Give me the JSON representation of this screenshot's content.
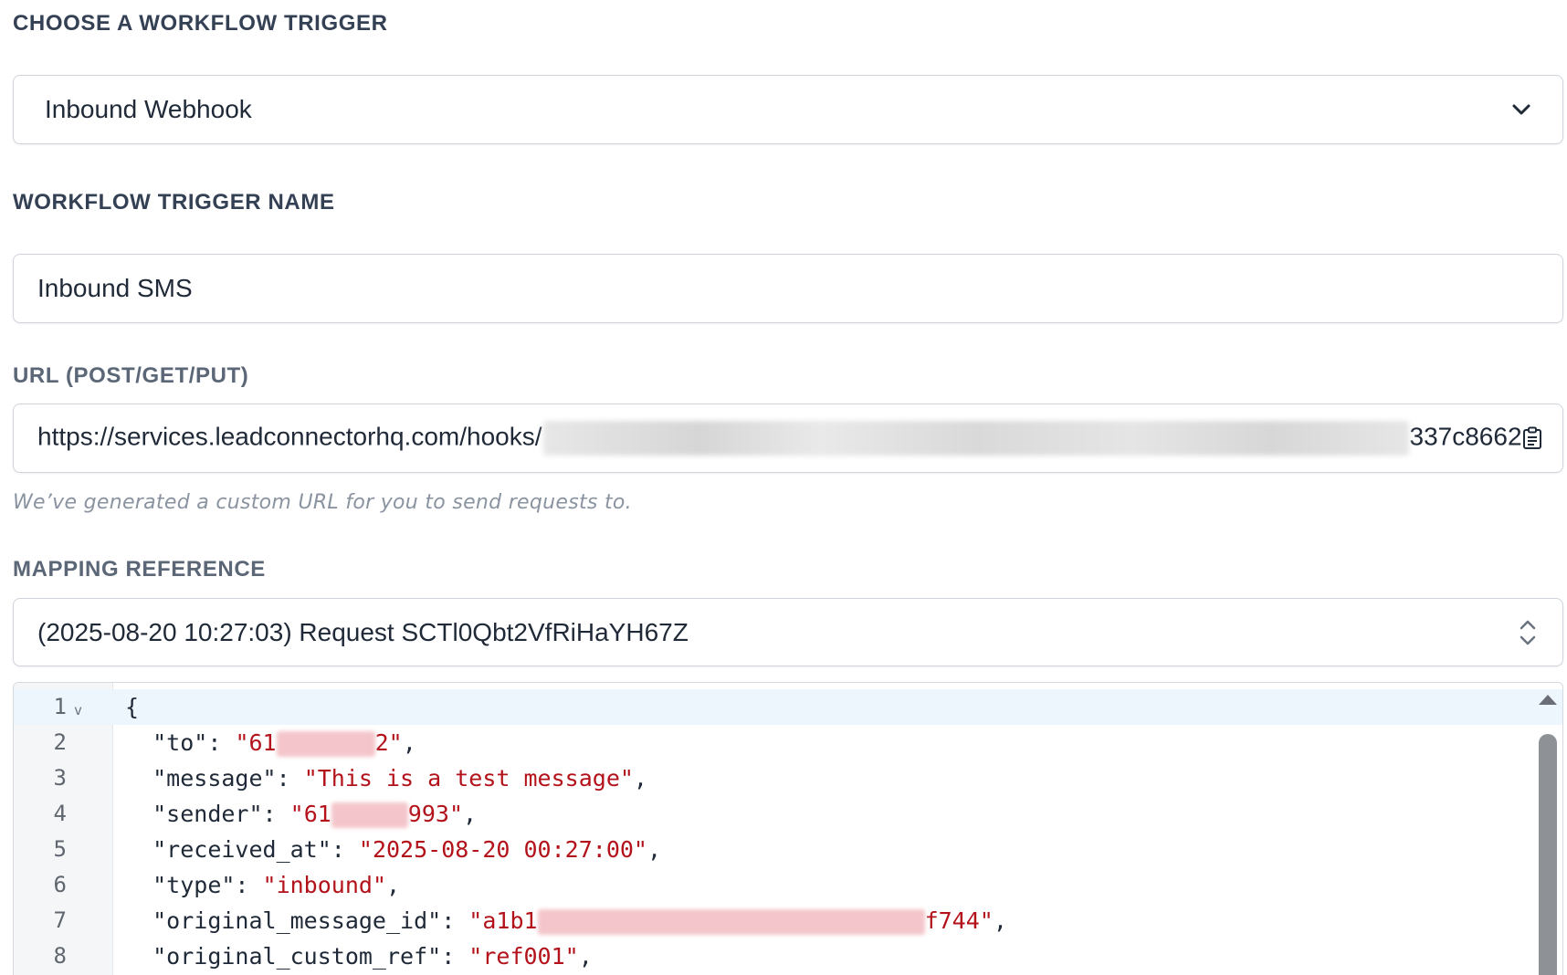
{
  "trigger_section": {
    "label": "CHOOSE A WORKFLOW TRIGGER",
    "selected": "Inbound Webhook"
  },
  "name_section": {
    "label": "WORKFLOW TRIGGER NAME",
    "value": "Inbound SMS"
  },
  "url_section": {
    "label": "URL (POST/GET/PUT)",
    "prefix": "https://services.leadconnectorhq.com/hooks/",
    "suffix": "337c8662",
    "hint": "We’ve generated a custom URL for you to send requests to."
  },
  "mapping_section": {
    "label": "MAPPING REFERENCE",
    "selected": "(2025-08-20 10:27:03) Request SCTl0Qbt2VfRiHaYH67Z"
  },
  "editor": {
    "lines": [
      {
        "n": "1",
        "open": "{"
      },
      {
        "n": "2",
        "key": "\"to\"",
        "val_start": "\"61",
        "val_end": "2\""
      },
      {
        "n": "3",
        "key": "\"message\"",
        "val": "\"This is a test message\""
      },
      {
        "n": "4",
        "key": "\"sender\"",
        "val_start": "\"61",
        "val_end": "993\""
      },
      {
        "n": "5",
        "key": "\"received_at\"",
        "val": "\"2025-08-20 00:27:00\""
      },
      {
        "n": "6",
        "key": "\"type\"",
        "val": "\"inbound\""
      },
      {
        "n": "7",
        "key": "\"original_message_id\"",
        "val_start": "\"a1b1",
        "val_end": "f744\""
      },
      {
        "n": "8",
        "key": "\"original_custom_ref\"",
        "val": "\"ref001\""
      }
    ]
  },
  "colors": {
    "string": "#b3121b",
    "label": "#344054",
    "border": "#cfd4dc"
  },
  "icons": [
    "chevron-down-icon",
    "sort-updown-icon",
    "clipboard-icon",
    "fold-arrow-icon",
    "scroll-up-arrow-icon"
  ]
}
